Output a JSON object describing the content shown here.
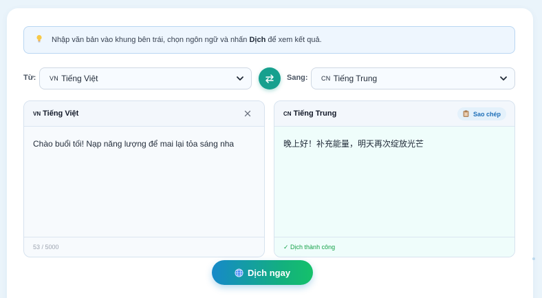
{
  "tip": {
    "icon": "lightbulb-icon",
    "before": "Nhập văn bản vào khung bên trái, chọn ngôn ngữ và nhấn ",
    "bold": "Dịch",
    "after": " để xem kết quả."
  },
  "source_lang": {
    "label": "Từ:",
    "code": "VN",
    "value": "Tiếng Việt"
  },
  "target_lang": {
    "label": "Sang:",
    "code": "CN",
    "value": "Tiếng Trung"
  },
  "source_panel": {
    "code": "VN",
    "title": "Tiếng Việt",
    "text": "Chào buổi tối! Nạp năng lượng để mai lại tỏa sáng nha",
    "char_count": "53 / 5000"
  },
  "target_panel": {
    "code": "CN",
    "title": "Tiếng Trung",
    "copy_label": "Sao chép",
    "text": "晚上好！补充能量，明天再次绽放光芒",
    "status": "✓ Dịch thành công"
  },
  "translate_button": {
    "label": "Dịch ngay"
  },
  "colors": {
    "accent": "#17a08e",
    "primary": "#1689c9",
    "success": "#16a34a"
  }
}
